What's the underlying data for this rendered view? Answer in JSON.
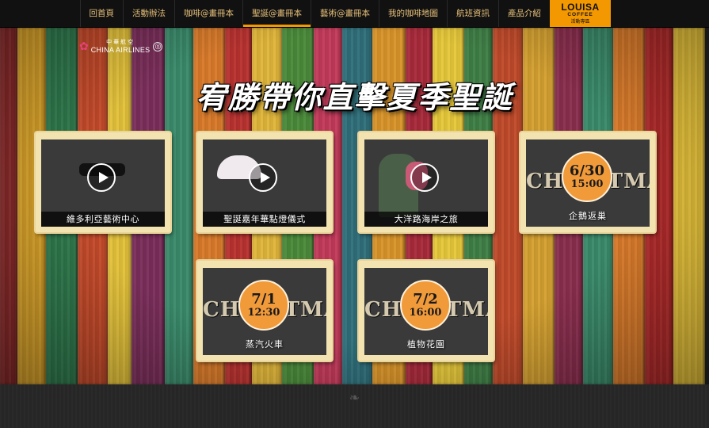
{
  "nav": {
    "items": [
      {
        "label": "回首頁",
        "active": false
      },
      {
        "label": "活動辦法",
        "active": false
      },
      {
        "label": "咖啡@畫冊本",
        "active": false
      },
      {
        "label": "聖誕@畫冊本",
        "active": true
      },
      {
        "label": "藝術@畫冊本",
        "active": false
      },
      {
        "label": "我的咖啡地圖",
        "active": false
      },
      {
        "label": "航班資訊",
        "active": false
      },
      {
        "label": "產品介紹",
        "active": false
      }
    ],
    "brand": {
      "line1": "LOUISA",
      "line2": "COFFEE",
      "line3": "活動專區"
    },
    "accent": "#f39800"
  },
  "sponsor": {
    "zh": "中華航空",
    "en": "CHINA AIRLINES"
  },
  "headline": "宥勝帶你直擊夏季聖誕",
  "videos": [
    {
      "caption": "維多利亞藝術中心",
      "icon": "play-icon"
    },
    {
      "caption": "聖誕嘉年華點燈儀式",
      "icon": "play-icon"
    },
    {
      "caption": "大洋路海岸之旅",
      "icon": "play-icon"
    }
  ],
  "events": [
    {
      "date": "6/30",
      "time": "15:00",
      "label": "企鵝返巢",
      "art_text": "CHRISTMAS"
    },
    {
      "date": "7/1",
      "time": "12:30",
      "label": "蒸汽火車",
      "art_text": "CHRISTMAS"
    },
    {
      "date": "7/2",
      "time": "16:00",
      "label": "植物花園",
      "art_text": "CHRISTMAS"
    }
  ],
  "planks": [
    "#8a2a2a",
    "#d9a22a",
    "#2f7a4d",
    "#c44a2a",
    "#e3c13a",
    "#7a2e5a",
    "#3a8a6a",
    "#d87a2a",
    "#b8322f",
    "#e0b53a",
    "#4a8a3a",
    "#c23a5a",
    "#2f6f7a",
    "#d9942a",
    "#a82a3a",
    "#e6c83a",
    "#3f7f46",
    "#c04a2a",
    "#d4a030",
    "#8a2e4e",
    "#3a8a6a",
    "#d87a2a",
    "#b02a2a",
    "#e6c23a"
  ]
}
